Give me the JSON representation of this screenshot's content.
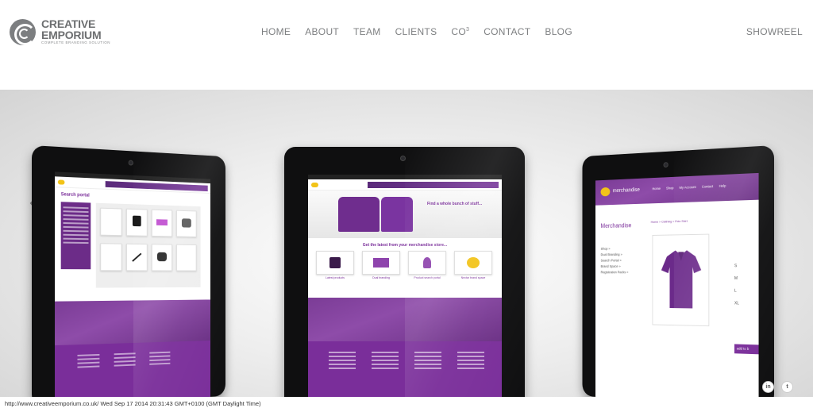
{
  "header": {
    "logo": {
      "line1": "CREATIVE",
      "line2": "EMPORIUM",
      "tagline": "COMPLETE BRANDING SOLUTION"
    },
    "nav": [
      {
        "label": "HOME"
      },
      {
        "label": "ABOUT"
      },
      {
        "label": "TEAM"
      },
      {
        "label": "CLIENTS"
      },
      {
        "label": "CO",
        "sup": "3"
      },
      {
        "label": "CONTACT"
      },
      {
        "label": "BLOG"
      }
    ],
    "showreel": "SHOWREEL"
  },
  "hero": {
    "left_tablet": {
      "portal_title": "Search portal"
    },
    "center_tablet": {
      "banner_title": "Find a whole bunch of stuff...",
      "section_title": "Get the latest from your merchandise store...",
      "cards": [
        "Latest products",
        "Dual branding",
        "Product search portal",
        "Nectar brand space"
      ]
    },
    "right_tablet": {
      "brand": "merchandise",
      "nav": [
        "Home",
        "Shop",
        "My Account",
        "Contact",
        "Help"
      ],
      "heading": "Merchandise",
      "breadcrumb": "Home  >  Clothing  >  Polo Shirt",
      "sidebar": [
        "Shop »",
        "Dual Branding »",
        "Search Portal »",
        "Brand Space »",
        "Registration Packs »"
      ],
      "sizes": [
        "S",
        "M",
        "L",
        "XL"
      ],
      "add_button": "add to b"
    }
  },
  "status_bar": "http://www.creativeemporium.co.uk/ Wed Sep 17 2014 20:31:43 GMT+0100 (GMT Daylight Time)",
  "social": [
    {
      "icon": "linkedin-icon",
      "glyph": "in"
    },
    {
      "icon": "twitter-icon",
      "glyph": "t"
    }
  ],
  "colors": {
    "nav_text": "#7d7f81",
    "brand_purple": "#7a2e9a",
    "logo_gray": "#6d6f71"
  }
}
